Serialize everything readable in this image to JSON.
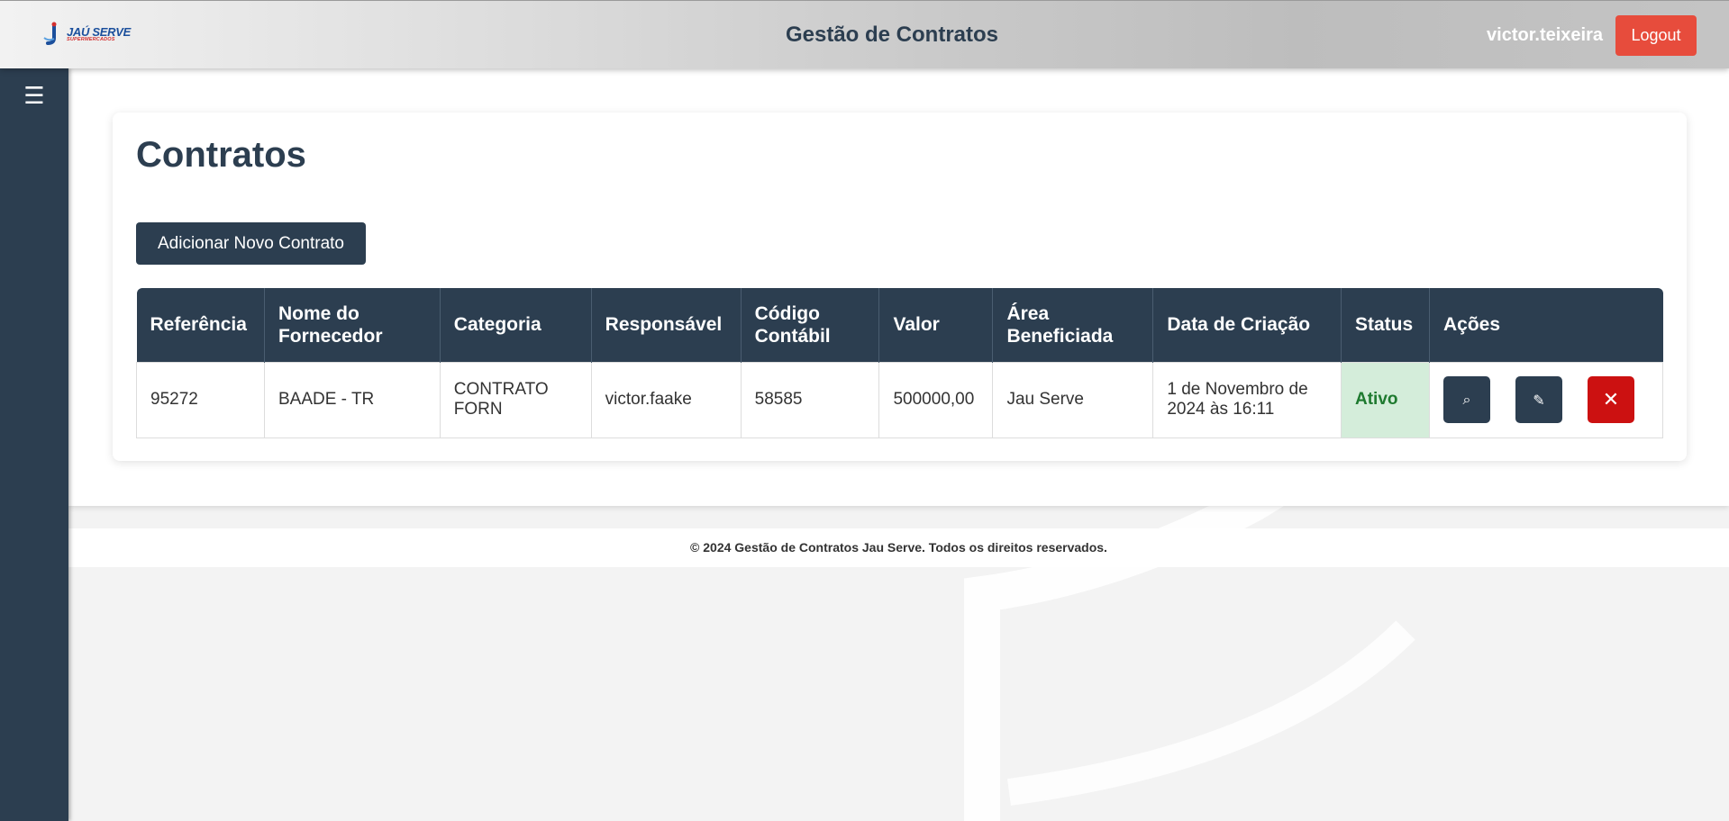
{
  "header": {
    "logo_main": "JAÚ SERVE",
    "logo_sub": "SUPERMERCADOS",
    "title": "Gestão de Contratos",
    "username": "victor.teixeira",
    "logout_label": "Logout"
  },
  "sidebar": {
    "menu_glyph": "☰"
  },
  "page": {
    "title": "Contratos",
    "add_button_label": "Adicionar Novo Contrato"
  },
  "table": {
    "columns": [
      "Referência",
      "Nome do Fornecedor",
      "Categoria",
      "Responsável",
      "Código Contábil",
      "Valor",
      "Área Beneficiada",
      "Data de Criação",
      "Status",
      "Ações"
    ],
    "rows": [
      {
        "referencia": "95272",
        "fornecedor": "BAADE - TR",
        "categoria": "CONTRATO FORN",
        "responsavel": "victor.faake",
        "codigo": "58585",
        "valor": "500000,00",
        "area": "Jau Serve",
        "data": "1 de Novembro de 2024 às 16:11",
        "status": "Ativo",
        "actions": {
          "view_icon": "⌕",
          "edit_icon": "✎",
          "delete_icon": "✕"
        }
      }
    ]
  },
  "footer": {
    "text": "© 2024 Gestão de Contratos Jau Serve. Todos os direitos reservados."
  },
  "colors": {
    "primary": "#2c3e50",
    "logout": "#e74c3c",
    "delete": "#cc1111",
    "status_bg": "#d4edda",
    "status_text": "#1e7a2f"
  }
}
